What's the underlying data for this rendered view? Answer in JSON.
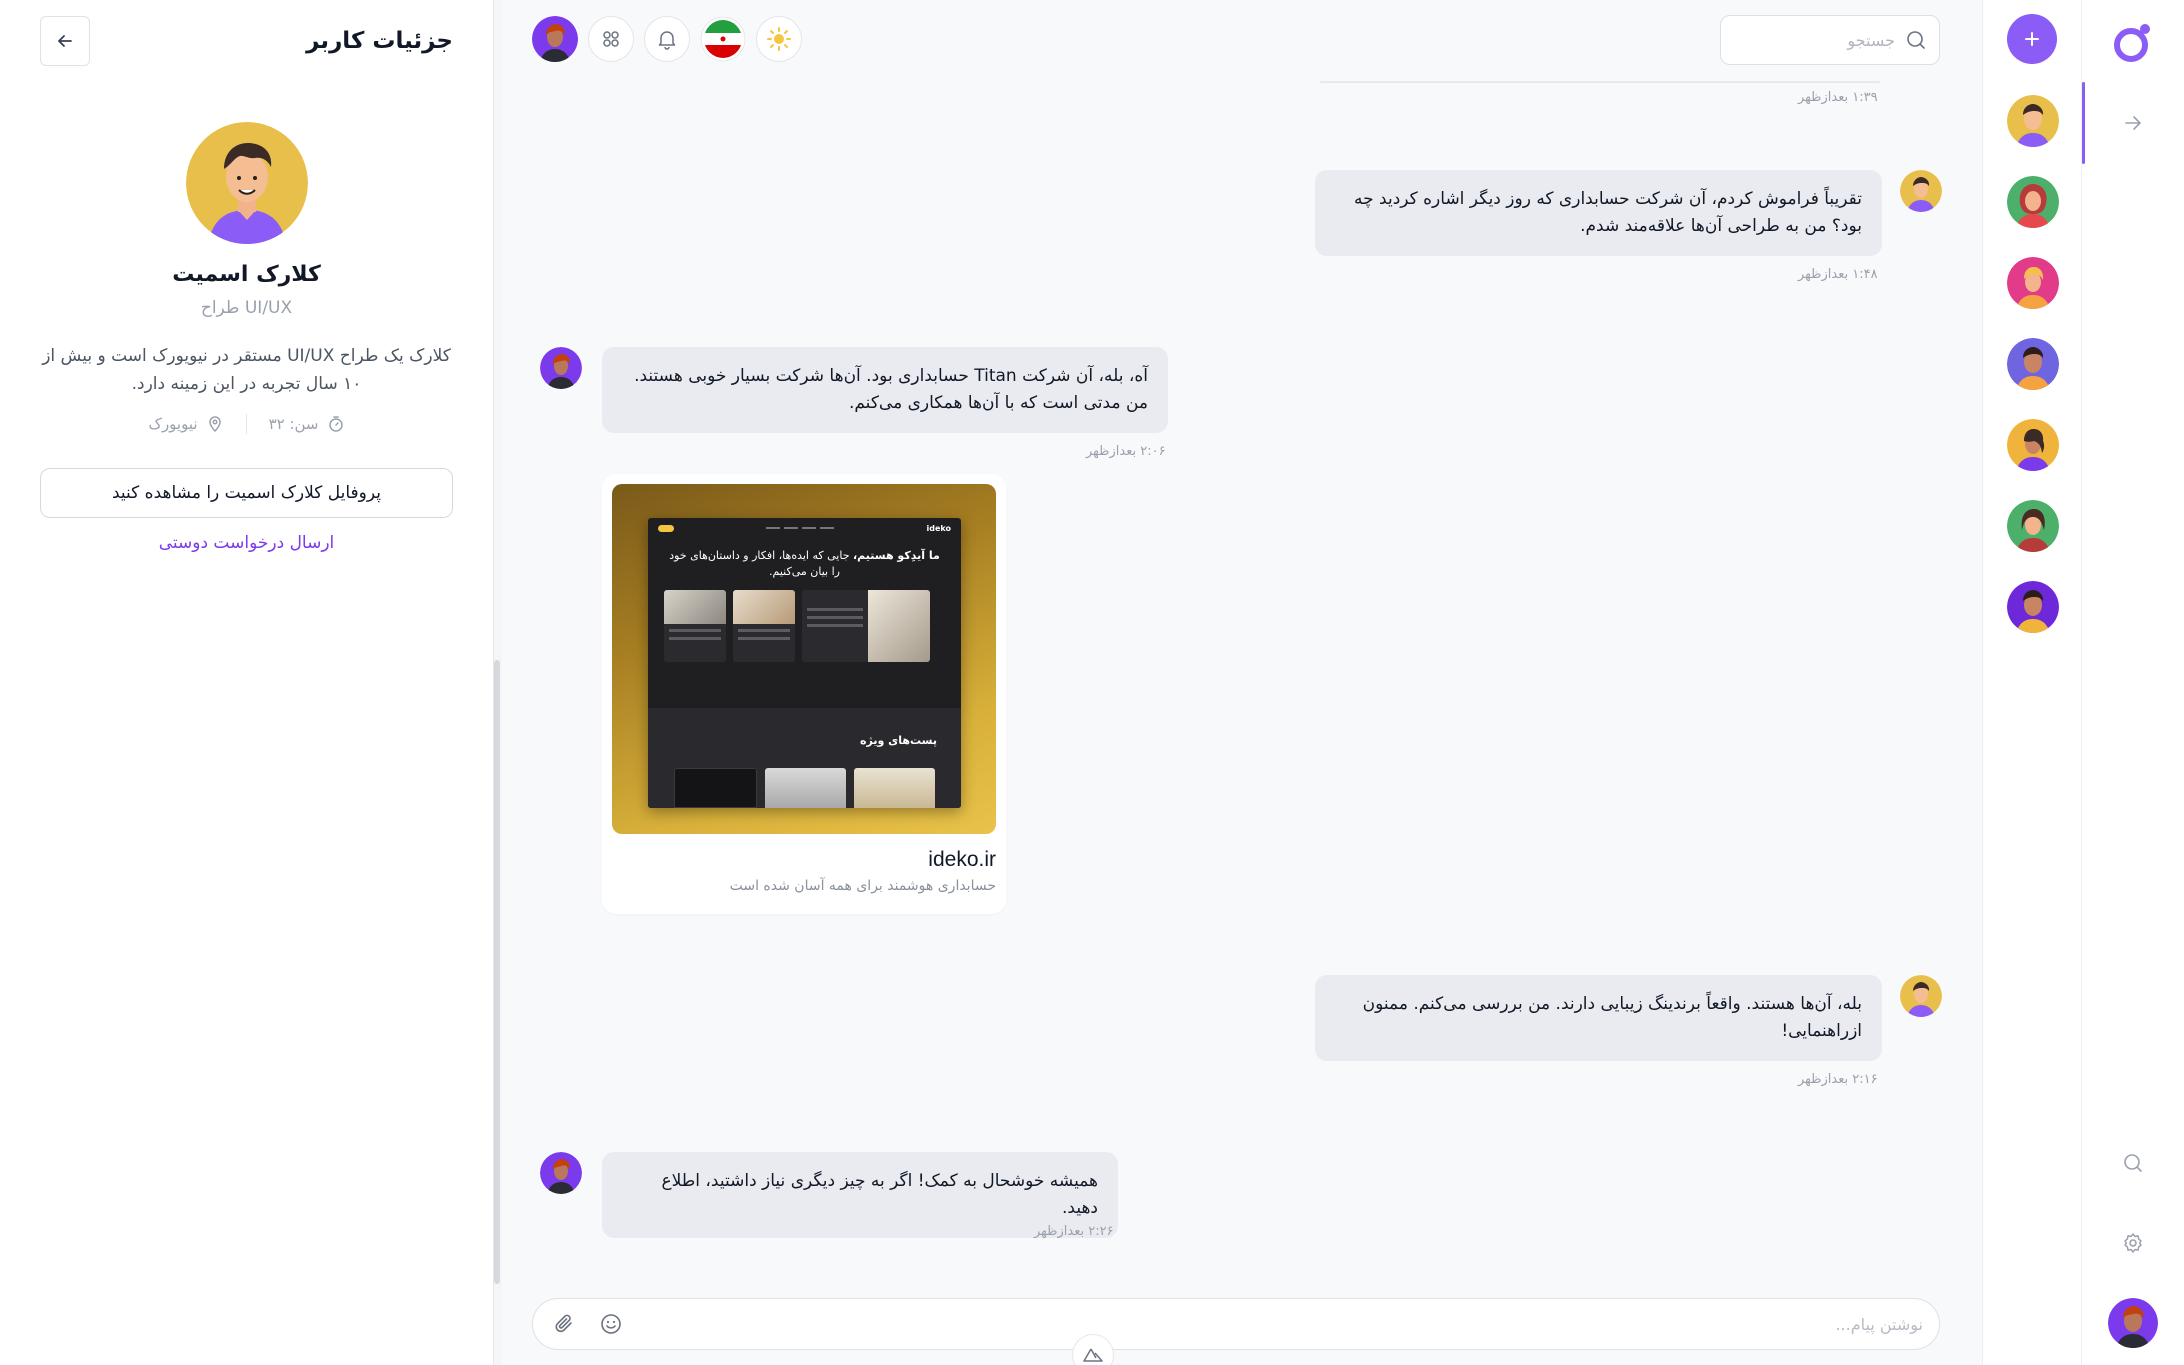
{
  "details": {
    "title": "جزئیات کاربر",
    "name": "کلارک اسمیت",
    "role": "طراح UI/UX",
    "bio": "کلارک یک طراح UI/UX مستقر در نیویورک است و بیش از ۱۰ سال تجربه در این زمینه دارد.",
    "age": "سن: ۳۲",
    "location": "نیویورک",
    "profile_button": "پروفایل کلارک اسمیت را مشاهده کنید",
    "friend_request": "ارسال درخواست دوستی"
  },
  "search": {
    "placeholder": "جستجو"
  },
  "messages": [
    {
      "time": "۱:۳۹ بعدازظهر"
    },
    {
      "text": "تقریباً فراموش کردم، آن شرکت حسابداری که روز دیگر اشاره کردید چه بود؟ من به طراحی آن‌ها علاقه‌مند شدم.",
      "time": "۱:۴۸ بعدازظهر"
    },
    {
      "text": "آه، بله، آن شرکت Titan حسابداری بود. آن‌ها شرکت بسیار خوبی هستند. من مدتی است که با آن‌ها همکاری می‌کنم.",
      "time": "۲:۰۶ بعدازظهر"
    },
    {
      "text": "بله، آن‌ها هستند. واقعاً برندینگ زیبایی دارند. من بررسی می‌کنم. ممنون ازراهنمایی!",
      "time": "۲:۱۶ بعدازظهر"
    },
    {
      "text": "همیشه خوشحال به کمک! اگر به چیز دیگری نیاز داشتید، اطلاع دهید.",
      "time": "۲:۲۶ بعدازظهر"
    }
  ],
  "link_preview": {
    "domain": "ideko.ir",
    "description": "حسابداری هوشمند برای همه آسان شده است",
    "hero_bold": "ما آیدِکو هستیم،",
    "hero_rest": " جایی که ایده‌ها، افکار و داستان‌های خود را بیان می‌کنیم.",
    "section_title": "پست‌های ویژه"
  },
  "composer": {
    "placeholder": "نوشتن پیام..."
  },
  "colors": {
    "accent": "#8b5cf6",
    "bubble": "#e9ebf0",
    "link": "#7c3aed"
  },
  "icons": [
    "back-arrow-icon",
    "age-icon",
    "location-pin-icon",
    "sun-icon",
    "iran-flag-icon",
    "bell-icon",
    "apps-grid-icon",
    "search-icon",
    "attach-icon",
    "emoji-icon",
    "plus-icon",
    "logo-icon",
    "arrow-right-icon",
    "gear-icon",
    "nuxt-icon"
  ]
}
